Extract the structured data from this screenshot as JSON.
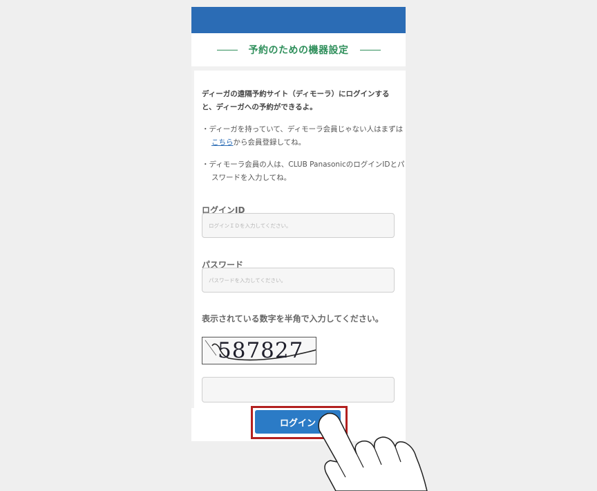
{
  "header": {
    "title": "予約のための機器設定"
  },
  "intro": {
    "text": "ディーガの遠隔予約サイト（ディモーラ）にログインすると、ディーガへの予約ができるよ。"
  },
  "notes": {
    "note1_prefix": "・ディーガを持っていて、ディモーラ会員じゃない人はまずは",
    "note1_link": "こちら",
    "note1_suffix": "から会員登録してね。",
    "note2": "・ディモーラ会員の人は、CLUB PanasonicのログインIDとパスワードを入力してね。"
  },
  "form": {
    "login_id_label": "ログインID",
    "login_id_placeholder": "ログインＩＤを入力してください。",
    "password_label": "パスワード",
    "password_placeholder": "パスワードを入力してください。",
    "captcha_label": "表示されている数字を半角で入力してください。",
    "captcha_digits": "587827",
    "captcha_value": ""
  },
  "actions": {
    "login_label": "ログイン"
  },
  "colors": {
    "header_bar": "#2b6cb5",
    "heading_green": "#2f8f5b",
    "button_blue": "#2b7bc6",
    "highlight_red": "#b3201f"
  }
}
